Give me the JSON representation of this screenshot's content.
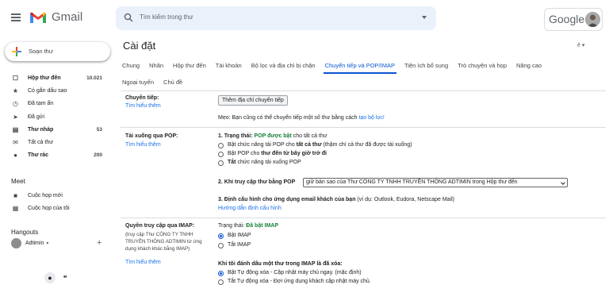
{
  "header": {
    "app_name": "Gmail",
    "search_placeholder": "Tìm kiếm trong thư",
    "account_brand": "Google"
  },
  "sidebar": {
    "compose_label": "Soạn thư",
    "items": [
      {
        "label": "Hộp thư đến",
        "count": "10.021",
        "icon": "inbox-icon",
        "bold": true
      },
      {
        "label": "Có gắn dấu sao",
        "count": "",
        "icon": "star-icon",
        "bold": false
      },
      {
        "label": "Đã tạm ẩn",
        "count": "",
        "icon": "clock-icon",
        "bold": false
      },
      {
        "label": "Đã gửi",
        "count": "",
        "icon": "send-icon",
        "bold": false
      },
      {
        "label": "Thư nháp",
        "count": "53",
        "icon": "draft-icon",
        "bold": true
      },
      {
        "label": "Tất cả thư",
        "count": "",
        "icon": "all-mail-icon",
        "bold": false
      },
      {
        "label": "Thư rác",
        "count": "200",
        "icon": "spam-icon",
        "bold": true
      }
    ],
    "meet_title": "Meet",
    "meet_items": [
      {
        "label": "Cuộc họp mới",
        "icon": "video-icon"
      },
      {
        "label": "Cuộc họp của tôi",
        "icon": "keyboard-icon"
      }
    ],
    "hangouts_title": "Hangouts",
    "hangouts_user": "Adtimin"
  },
  "settings": {
    "title": "Cài đặt",
    "lang_indicator": "ê",
    "tabs_row1": [
      "Chung",
      "Nhãn",
      "Hộp thư đến",
      "Tài khoản",
      "Bộ lọc và địa chỉ bị chặn",
      "Chuyển tiếp và POP/IMAP",
      "Tiện ích bổ sung",
      "Trò chuyện và họp",
      "Nâng cao"
    ],
    "tabs_row2": [
      "Ngoại tuyến",
      "Chủ đề"
    ],
    "active_tab": "Chuyển tiếp và POP/IMAP",
    "forwarding": {
      "label": "Chuyển tiếp:",
      "learn_more": "Tìm hiểu thêm",
      "button": "Thêm địa chỉ chuyển tiếp",
      "tip_prefix": "Mẹo: Bạn cũng có thể chuyển tiếp một số thư bằng cách ",
      "tip_link": "tạo bộ lọc!"
    },
    "pop": {
      "label": "Tải xuống qua POP:",
      "learn_more": "Tìm hiểu thêm",
      "status_prefix": "1. Trạng thái: ",
      "status_value": "POP được bật",
      "status_suffix": " cho tất cả thư",
      "options": [
        {
          "pre": "Bật chức năng tải POP cho ",
          "bold": "tất cả thư",
          "post": " (thậm chí cả thư đã được tải xuống)",
          "selected": false
        },
        {
          "pre": "Bật POP cho ",
          "bold": "thư đến từ bây giờ trở đi",
          "post": "",
          "selected": false
        },
        {
          "pre": "",
          "bold": "Tắt",
          "post": " chức năng tải xuống POP",
          "selected": false
        }
      ],
      "access_label": "2. Khi truy cập thư bằng POP",
      "access_value": "giữ bản sao của Thư CÔNG TY TNHH TRUYỀN THÔNG ADTIMIN trong Hộp thư đến",
      "config_bold": "3. Định cấu hình cho ứng dụng email khách của bạn",
      "config_rest": " (ví dụ: Outlook, Eudora, Netscape Mail)",
      "config_link": "Hướng dẫn định cấu hình"
    },
    "imap": {
      "label": "Quyền truy cập qua IMAP:",
      "desc": "(truy cập Thư CÔNG TY TNHH TRUYỀN THÔNG ADTIMIN từ ứng dụng khách khác bằng IMAP)",
      "learn_more": "Tìm hiểu thêm",
      "status_prefix": "Trạng thái: ",
      "status_value": "Đã bật IMAP",
      "options": [
        {
          "label": "Bật IMAP",
          "selected": true
        },
        {
          "label": "Tắt IMAP",
          "selected": false
        }
      ],
      "delete_title": "Khi tôi đánh dấu một thư trong IMAP là đã xóa:",
      "delete_options": [
        {
          "label": "Bật Tự động xóa - Cập nhật máy chủ ngay. (mặc định)",
          "selected": true
        },
        {
          "label": "Tắt Tự động xóa - Đợi ứng dụng khách cập nhật máy chủ.",
          "selected": false
        }
      ]
    }
  }
}
